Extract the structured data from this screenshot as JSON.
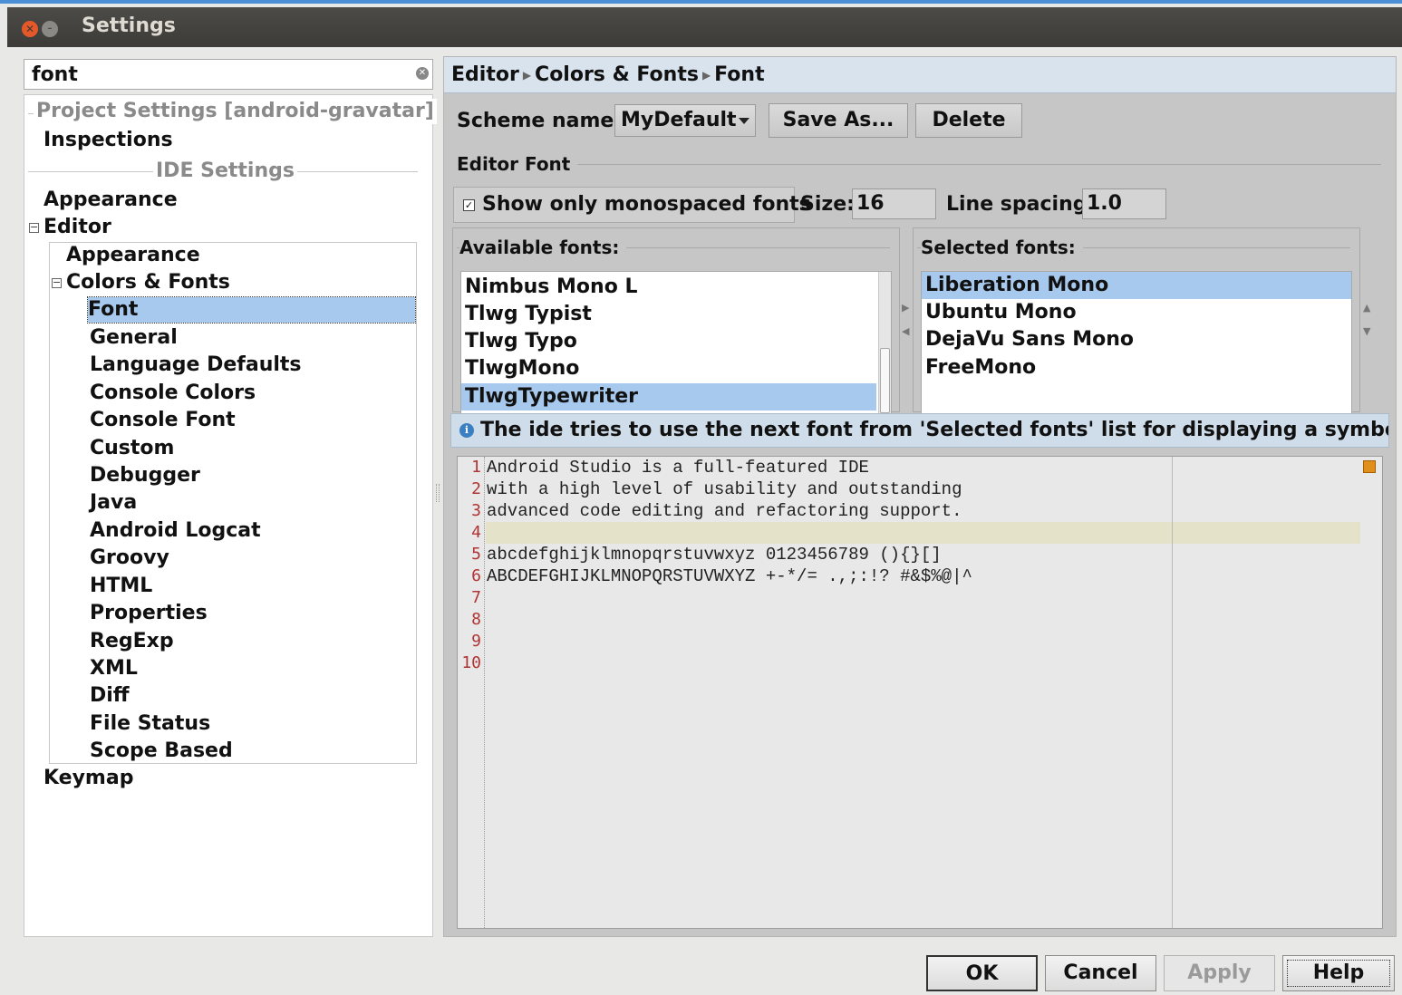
{
  "window": {
    "title": "Settings"
  },
  "search": {
    "value": "font"
  },
  "tree": {
    "project_settings_label": "Project Settings [android-gravatar]",
    "inspections": "Inspections",
    "ide_settings_label": "IDE Settings",
    "appearance": "Appearance",
    "editor": "Editor",
    "editor_children": {
      "appearance": "Appearance",
      "colors_fonts": "Colors & Fonts",
      "colors_fonts_children": [
        "Font",
        "General",
        "Language Defaults",
        "Console Colors",
        "Console Font",
        "Custom",
        "Debugger",
        "Java",
        "Android Logcat",
        "Groovy",
        "HTML",
        "Properties",
        "RegExp",
        "XML",
        "Diff",
        "File Status",
        "Scope Based"
      ]
    },
    "keymap": "Keymap",
    "selected": "Font"
  },
  "breadcrumb": [
    "Editor",
    "Colors & Fonts",
    "Font"
  ],
  "scheme": {
    "label": "Scheme name:",
    "value": "MyDefault",
    "save_as": "Save As...",
    "delete": "Delete"
  },
  "editor_font": {
    "group_title": "Editor Font",
    "monospaced_label": "Show only monospaced fonts",
    "monospaced_checked": true,
    "size_label": "Size:",
    "size_value": "16",
    "line_spacing_label": "Line spacing:",
    "line_spacing_value": "1.0"
  },
  "available_fonts": {
    "title": "Available fonts:",
    "items": [
      "Nimbus Mono L",
      "Tlwg Typist",
      "Tlwg Typo",
      "TlwgMono",
      "TlwgTypewriter"
    ],
    "selected": "TlwgTypewriter"
  },
  "selected_fonts": {
    "title": "Selected fonts:",
    "items": [
      "Liberation Mono",
      "Ubuntu Mono",
      "DejaVu Sans Mono",
      "FreeMono"
    ],
    "selected": "Liberation Mono"
  },
  "info": {
    "text": "The ide tries to use the next font from 'Selected fonts' list for displaying a symbol if ..."
  },
  "preview": {
    "line_numbers": [
      "1",
      "2",
      "3",
      "4",
      "5",
      "6",
      "7",
      "8",
      "9",
      "10"
    ],
    "lines": [
      "Android Studio is a full-featured IDE",
      "with a high level of usability and outstanding",
      "advanced code editing and refactoring support.",
      "",
      "abcdefghijklmnopqrstuvwxyz 0123456789 (){}[]",
      "ABCDEFGHIJKLMNOPQRSTUVWXYZ +-*/= .,;:!? #&$%@|^"
    ]
  },
  "buttons": {
    "ok": "OK",
    "cancel": "Cancel",
    "apply": "Apply",
    "help": "Help"
  },
  "colors": {
    "selection": "#a8c9ee",
    "titlebar": "#3c3b37",
    "current_line": "#e4e3c9",
    "line_number": "#b03434"
  }
}
